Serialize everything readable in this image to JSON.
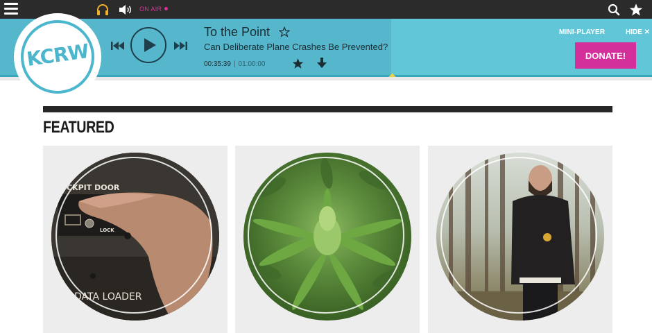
{
  "topbar": {
    "menu_icon": "hamburger-menu-icon",
    "listen_icon": "headphones-icon",
    "volume_icon": "speaker-icon",
    "on_air_label": "ON AIR",
    "search_icon": "search-icon",
    "favorites_icon": "star-icon"
  },
  "player": {
    "logo_text": "KCRW",
    "show_title": "To the Point",
    "episode_title": "Can Deliberate Plane Crashes Be Prevented?",
    "elapsed": "00:35:39",
    "separator": "|",
    "duration": "01:00:00",
    "mini_player_label": "MINI-PLAYER",
    "hide_label": "HIDE ✕",
    "donate_label": "DONATE!",
    "progress": 0.6
  },
  "featured": {
    "heading": "FEATURED",
    "cards": [
      {
        "image_text_1": "CKPIT DOOR",
        "image_text_2": "LOCK",
        "image_text_3": "DATA LOADER"
      },
      {},
      {}
    ]
  },
  "colors": {
    "accent": "#d3309c",
    "player_bg": "#61c6d8",
    "topbar_bg": "#2b2b2b"
  }
}
